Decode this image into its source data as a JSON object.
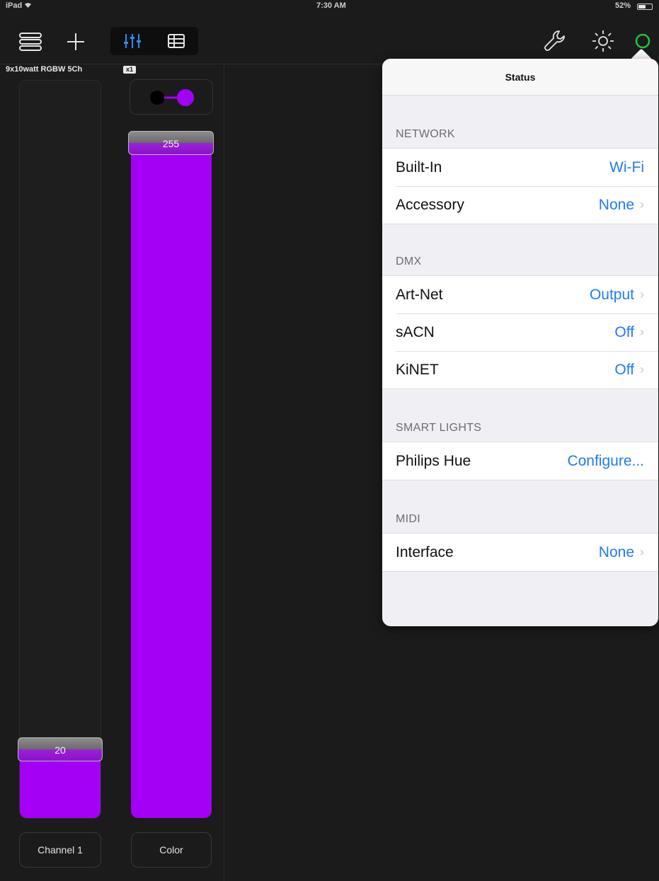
{
  "status_bar": {
    "device": "iPad",
    "time": "7:30 AM",
    "battery": "52%",
    "battery_level": 0.52
  },
  "fixture": {
    "title": "9x10watt RGBW 5Ch",
    "badge": "x1"
  },
  "channels": [
    {
      "label": "Channel 1",
      "value": "20",
      "level": 20
    },
    {
      "label": "Color",
      "value": "255",
      "level": 255
    }
  ],
  "colors": {
    "accent_purple": "#a400f5",
    "link_blue": "#1e7cf0",
    "status_green": "#22c53a"
  },
  "popover": {
    "title": "Status",
    "sections": [
      {
        "title": "NETWORK",
        "rows": [
          {
            "label": "Built-In",
            "value": "Wi-Fi",
            "chevron": false
          },
          {
            "label": "Accessory",
            "value": "None",
            "chevron": true
          }
        ]
      },
      {
        "title": "DMX",
        "rows": [
          {
            "label": "Art-Net",
            "value": "Output",
            "chevron": true
          },
          {
            "label": "sACN",
            "value": "Off",
            "chevron": true
          },
          {
            "label": "KiNET",
            "value": "Off",
            "chevron": true
          }
        ]
      },
      {
        "title": "SMART LIGHTS",
        "rows": [
          {
            "label": "Philips Hue",
            "value": "Configure...",
            "chevron": false
          }
        ]
      },
      {
        "title": "MIDI",
        "rows": [
          {
            "label": "Interface",
            "value": "None",
            "chevron": true
          }
        ]
      }
    ]
  },
  "icons": [
    "menu-icon",
    "add-icon",
    "faders-icon",
    "grid-icon",
    "wrench-icon",
    "brightness-icon",
    "status-icon",
    "wifi-icon"
  ]
}
